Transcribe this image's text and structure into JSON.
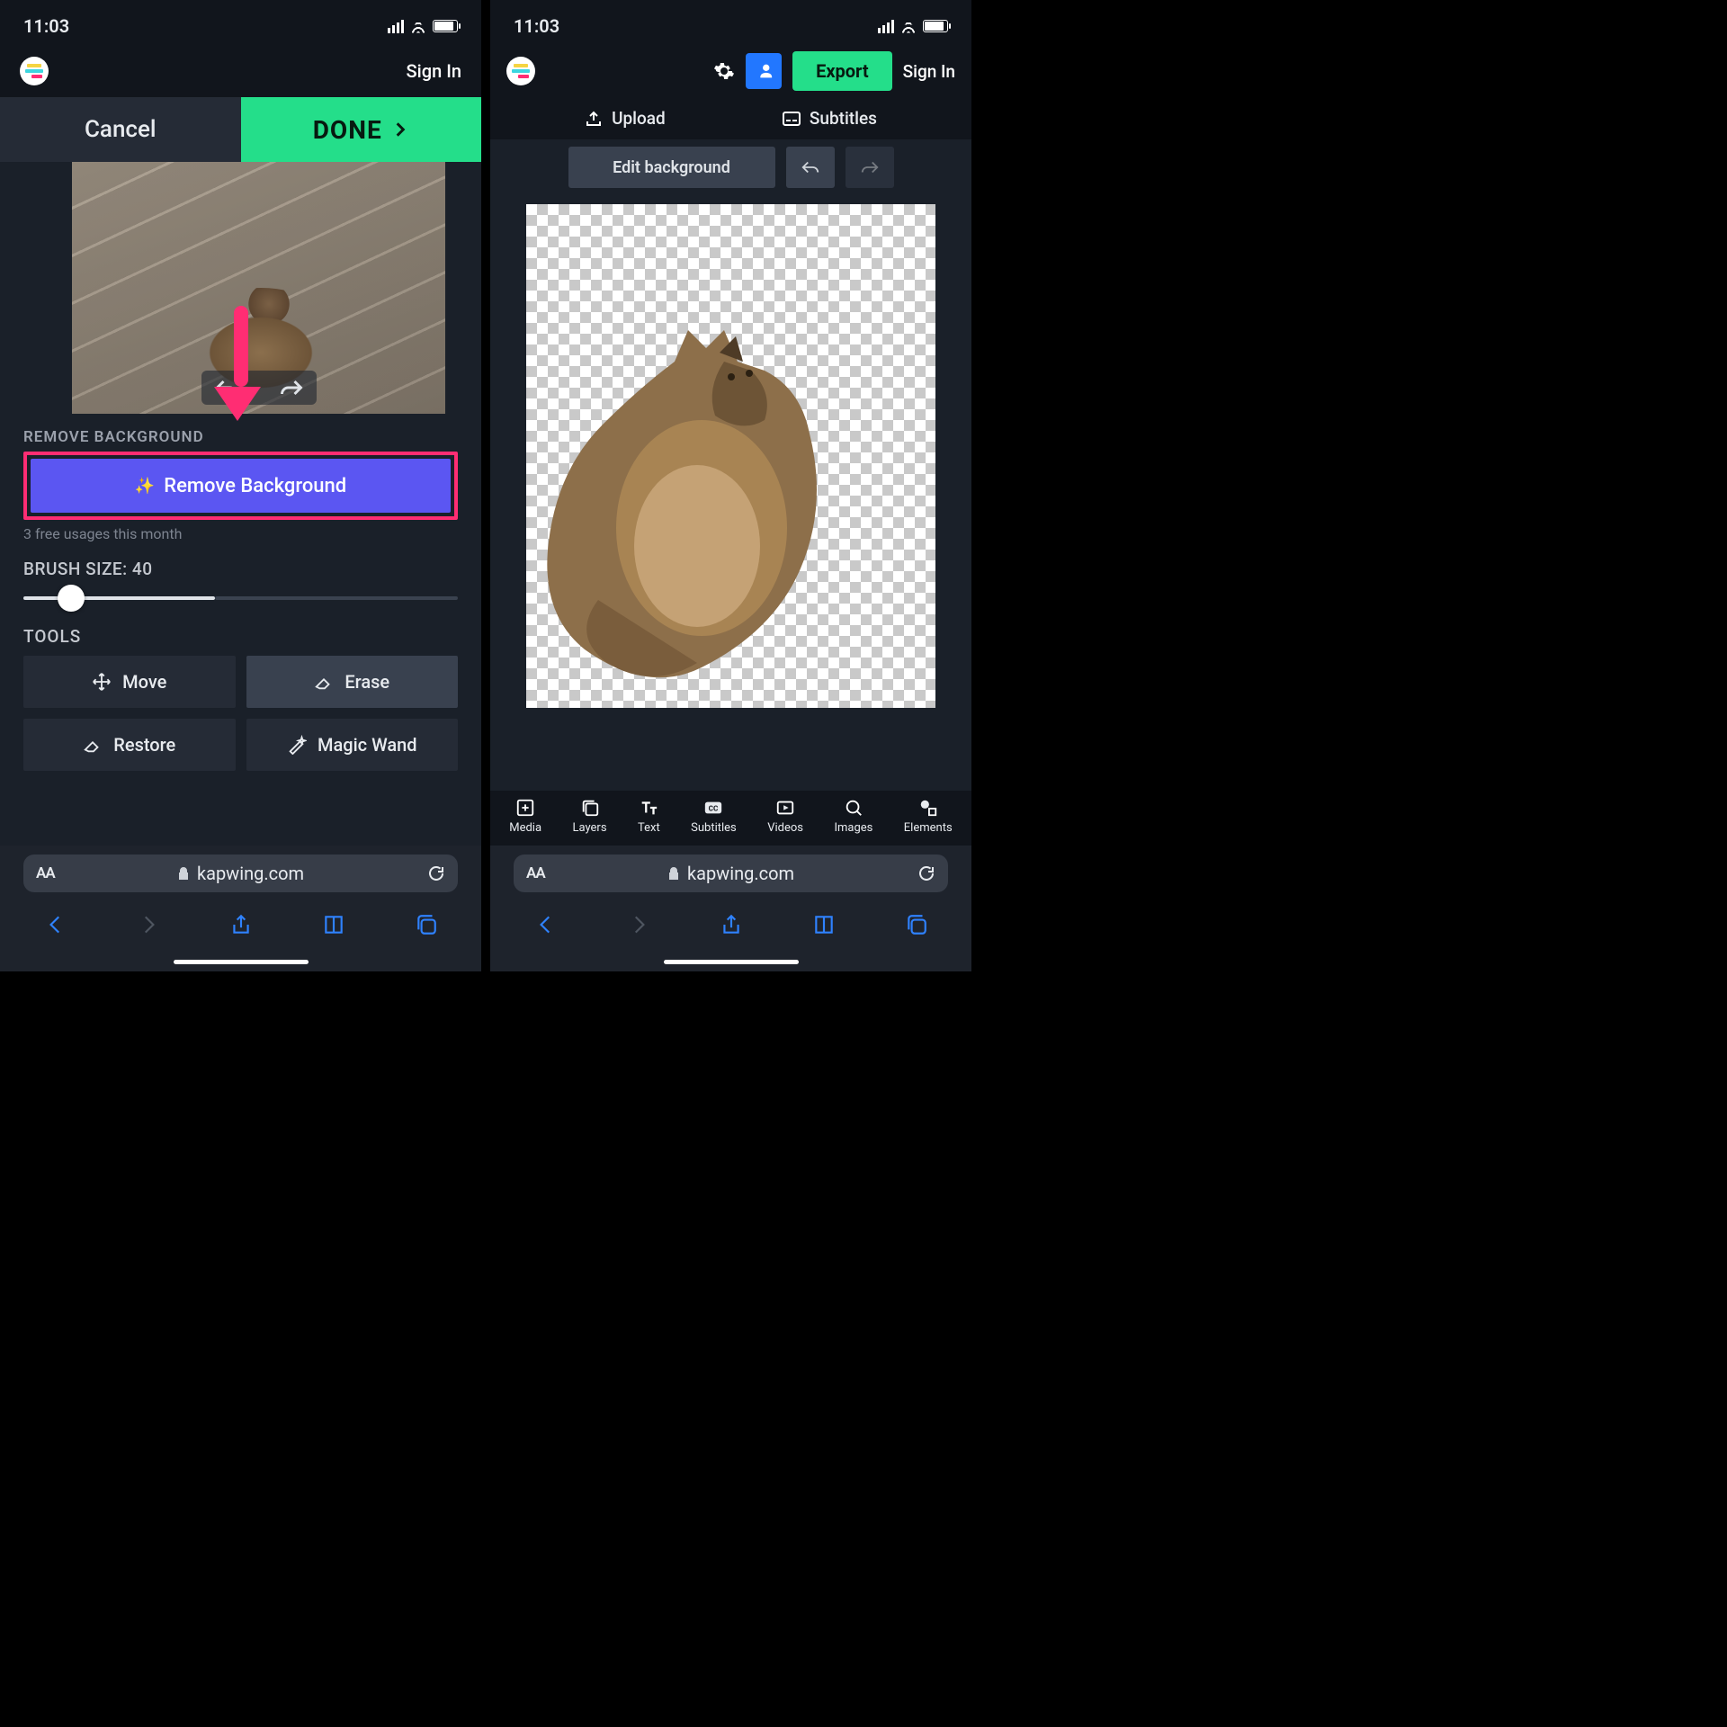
{
  "status": {
    "time": "11:03"
  },
  "header": {
    "signin": "Sign In"
  },
  "left": {
    "cancel": "Cancel",
    "done": "DONE",
    "remove_bg_label": "REMOVE BACKGROUND",
    "remove_bg_btn": "Remove Background",
    "usage_hint": "3 free usages this month",
    "brush_label": "BRUSH SIZE: 40",
    "tools_label": "TOOLS",
    "tools": {
      "move": "Move",
      "erase": "Erase",
      "restore": "Restore",
      "magic": "Magic Wand"
    }
  },
  "right": {
    "export": "Export",
    "signin": "Sign In",
    "upload": "Upload",
    "subtitles_tab": "Subtitles",
    "edit_bg": "Edit background",
    "tabs": {
      "media": "Media",
      "layers": "Layers",
      "text": "Text",
      "subtitles": "Subtitles",
      "videos": "Videos",
      "images": "Images",
      "elements": "Elements"
    }
  },
  "browser": {
    "domain": "kapwing.com",
    "aa": "AA"
  }
}
